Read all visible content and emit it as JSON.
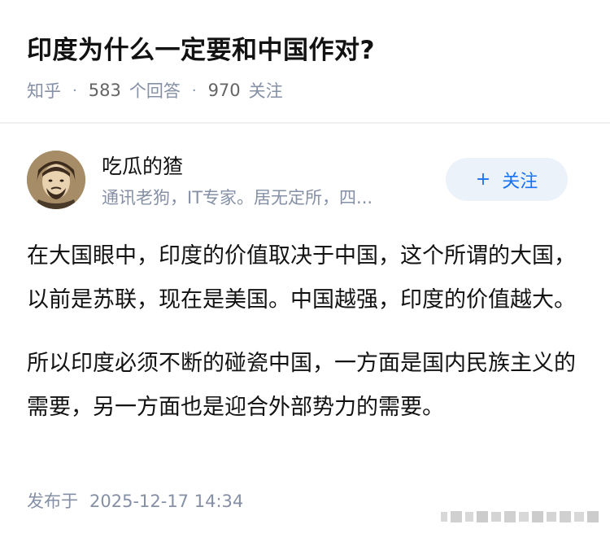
{
  "question": {
    "title": "印度为什么一定要和中国作对?",
    "source": "知乎",
    "answer_count": "583",
    "answer_label": "个回答",
    "follower_count": "970",
    "follower_label": "关注"
  },
  "author": {
    "name": "吃瓜的猹",
    "bio": "通讯老狗，IT专家。居无定所，四...",
    "follow_label": "关注",
    "follow_plus": "+"
  },
  "answer": {
    "paragraphs": [
      "在大国眼中，印度的价值取决于中国，这个所谓的大国，以前是苏联，现在是美国。中国越强，印度的价值越大。",
      "所以印度必须不断的碰瓷中国，一方面是国内民族主义的需要，另一方面也是迎合外部势力的需要。"
    ],
    "publish_label": "发布于",
    "publish_time": "2025-12-17 14:34"
  },
  "colors": {
    "accent": "#1772f6",
    "follow_bg": "#ebf2fa",
    "meta_gray": "#8590a6"
  }
}
